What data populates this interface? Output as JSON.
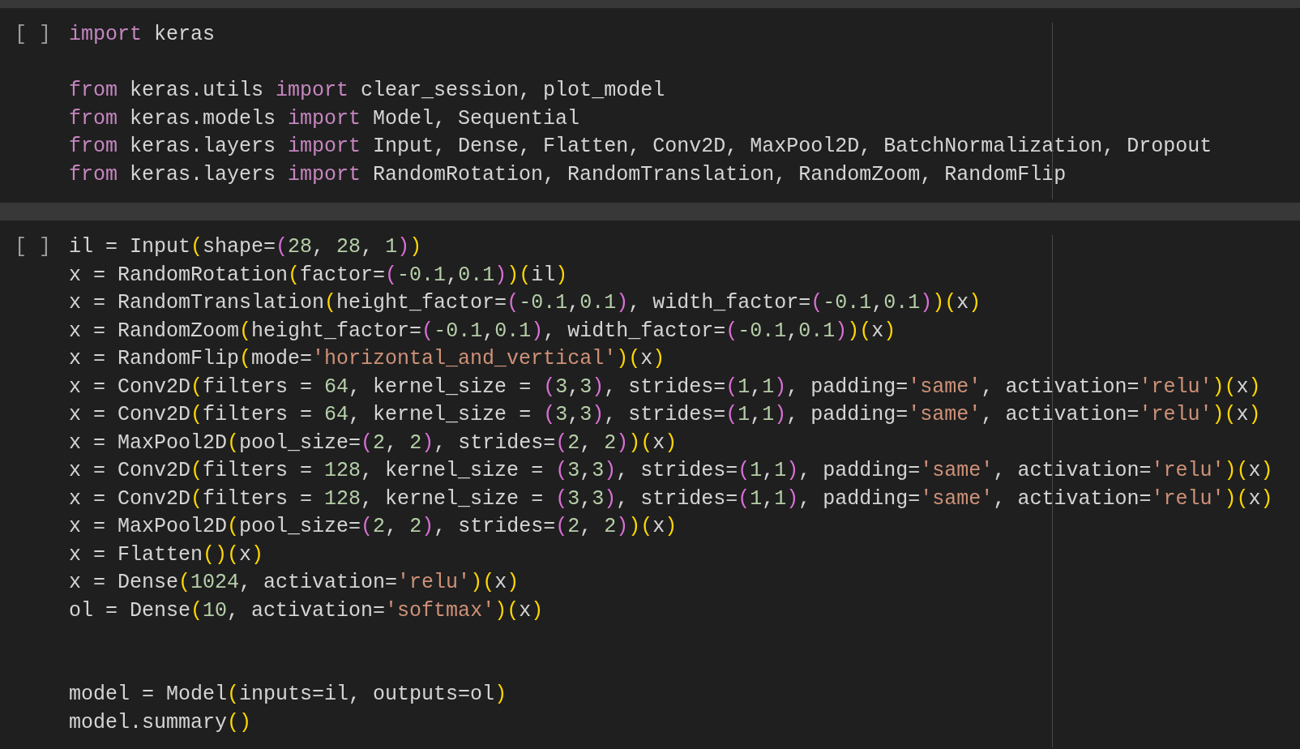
{
  "cells": [
    {
      "execution_count": "[ ]",
      "lines": [
        {
          "kind": "code",
          "tokens": [
            {
              "kind": "kw",
              "text": "import"
            },
            {
              "kind": "id",
              "text": " keras"
            }
          ]
        },
        {
          "kind": "blank"
        },
        {
          "kind": "code",
          "tokens": [
            {
              "kind": "kw",
              "text": "from"
            },
            {
              "kind": "id",
              "text": " keras.utils "
            },
            {
              "kind": "kw",
              "text": "import"
            },
            {
              "kind": "id",
              "text": " clear_session, plot_model"
            }
          ]
        },
        {
          "kind": "code",
          "tokens": [
            {
              "kind": "kw",
              "text": "from"
            },
            {
              "kind": "id",
              "text": " keras.models "
            },
            {
              "kind": "kw",
              "text": "import"
            },
            {
              "kind": "id",
              "text": " Model, Sequential"
            }
          ]
        },
        {
          "kind": "code",
          "tokens": [
            {
              "kind": "kw",
              "text": "from"
            },
            {
              "kind": "id",
              "text": " keras.layers "
            },
            {
              "kind": "kw",
              "text": "import"
            },
            {
              "kind": "id",
              "text": " Input, Dense, Flatten, Conv2D, MaxPool2D, BatchNormalization, Dropout"
            }
          ]
        },
        {
          "kind": "code",
          "tokens": [
            {
              "kind": "kw",
              "text": "from"
            },
            {
              "kind": "id",
              "text": " keras.layers "
            },
            {
              "kind": "kw",
              "text": "import"
            },
            {
              "kind": "id",
              "text": " RandomRotation, RandomTranslation, RandomZoom, RandomFlip"
            }
          ]
        }
      ]
    },
    {
      "execution_count": "[ ]",
      "lines": [
        {
          "kind": "code",
          "tokens": [
            {
              "kind": "id",
              "text": "il = Input"
            },
            {
              "kind": "p1",
              "text": "("
            },
            {
              "kind": "id",
              "text": "shape="
            },
            {
              "kind": "p2",
              "text": "("
            },
            {
              "kind": "num",
              "text": "28"
            },
            {
              "kind": "id",
              "text": ", "
            },
            {
              "kind": "num",
              "text": "28"
            },
            {
              "kind": "id",
              "text": ", "
            },
            {
              "kind": "num",
              "text": "1"
            },
            {
              "kind": "p2",
              "text": ")"
            },
            {
              "kind": "p1",
              "text": ")"
            }
          ]
        },
        {
          "kind": "code",
          "tokens": [
            {
              "kind": "id",
              "text": "x = RandomRotation"
            },
            {
              "kind": "p1",
              "text": "("
            },
            {
              "kind": "id",
              "text": "factor="
            },
            {
              "kind": "p2",
              "text": "("
            },
            {
              "kind": "num",
              "text": "-0.1"
            },
            {
              "kind": "id",
              "text": ","
            },
            {
              "kind": "num",
              "text": "0.1"
            },
            {
              "kind": "p2",
              "text": ")"
            },
            {
              "kind": "p1",
              "text": ")("
            },
            {
              "kind": "id",
              "text": "il"
            },
            {
              "kind": "p1",
              "text": ")"
            }
          ]
        },
        {
          "kind": "code",
          "tokens": [
            {
              "kind": "id",
              "text": "x = RandomTranslation"
            },
            {
              "kind": "p1",
              "text": "("
            },
            {
              "kind": "id",
              "text": "height_factor="
            },
            {
              "kind": "p2",
              "text": "("
            },
            {
              "kind": "num",
              "text": "-0.1"
            },
            {
              "kind": "id",
              "text": ","
            },
            {
              "kind": "num",
              "text": "0.1"
            },
            {
              "kind": "p2",
              "text": ")"
            },
            {
              "kind": "id",
              "text": ", width_factor="
            },
            {
              "kind": "p2",
              "text": "("
            },
            {
              "kind": "num",
              "text": "-0.1"
            },
            {
              "kind": "id",
              "text": ","
            },
            {
              "kind": "num",
              "text": "0.1"
            },
            {
              "kind": "p2",
              "text": ")"
            },
            {
              "kind": "p1",
              "text": ")("
            },
            {
              "kind": "id",
              "text": "x"
            },
            {
              "kind": "p1",
              "text": ")"
            }
          ]
        },
        {
          "kind": "code",
          "tokens": [
            {
              "kind": "id",
              "text": "x = RandomZoom"
            },
            {
              "kind": "p1",
              "text": "("
            },
            {
              "kind": "id",
              "text": "height_factor="
            },
            {
              "kind": "p2",
              "text": "("
            },
            {
              "kind": "num",
              "text": "-0.1"
            },
            {
              "kind": "id",
              "text": ","
            },
            {
              "kind": "num",
              "text": "0.1"
            },
            {
              "kind": "p2",
              "text": ")"
            },
            {
              "kind": "id",
              "text": ", width_factor="
            },
            {
              "kind": "p2",
              "text": "("
            },
            {
              "kind": "num",
              "text": "-0.1"
            },
            {
              "kind": "id",
              "text": ","
            },
            {
              "kind": "num",
              "text": "0.1"
            },
            {
              "kind": "p2",
              "text": ")"
            },
            {
              "kind": "p1",
              "text": ")("
            },
            {
              "kind": "id",
              "text": "x"
            },
            {
              "kind": "p1",
              "text": ")"
            }
          ]
        },
        {
          "kind": "code",
          "tokens": [
            {
              "kind": "id",
              "text": "x = RandomFlip"
            },
            {
              "kind": "p1",
              "text": "("
            },
            {
              "kind": "id",
              "text": "mode="
            },
            {
              "kind": "str",
              "text": "'horizontal_and_vertical'"
            },
            {
              "kind": "p1",
              "text": ")("
            },
            {
              "kind": "id",
              "text": "x"
            },
            {
              "kind": "p1",
              "text": ")"
            }
          ]
        },
        {
          "kind": "code",
          "tokens": [
            {
              "kind": "id",
              "text": "x = Conv2D"
            },
            {
              "kind": "p1",
              "text": "("
            },
            {
              "kind": "id",
              "text": "filters = "
            },
            {
              "kind": "num",
              "text": "64"
            },
            {
              "kind": "id",
              "text": ", kernel_size = "
            },
            {
              "kind": "p2",
              "text": "("
            },
            {
              "kind": "num",
              "text": "3"
            },
            {
              "kind": "id",
              "text": ","
            },
            {
              "kind": "num",
              "text": "3"
            },
            {
              "kind": "p2",
              "text": ")"
            },
            {
              "kind": "id",
              "text": ", strides="
            },
            {
              "kind": "p2",
              "text": "("
            },
            {
              "kind": "num",
              "text": "1"
            },
            {
              "kind": "id",
              "text": ","
            },
            {
              "kind": "num",
              "text": "1"
            },
            {
              "kind": "p2",
              "text": ")"
            },
            {
              "kind": "id",
              "text": ", padding="
            },
            {
              "kind": "str",
              "text": "'same'"
            },
            {
              "kind": "id",
              "text": ", activation="
            },
            {
              "kind": "str",
              "text": "'relu'"
            },
            {
              "kind": "p1",
              "text": ")("
            },
            {
              "kind": "id",
              "text": "x"
            },
            {
              "kind": "p1",
              "text": ")"
            }
          ]
        },
        {
          "kind": "code",
          "tokens": [
            {
              "kind": "id",
              "text": "x = Conv2D"
            },
            {
              "kind": "p1",
              "text": "("
            },
            {
              "kind": "id",
              "text": "filters = "
            },
            {
              "kind": "num",
              "text": "64"
            },
            {
              "kind": "id",
              "text": ", kernel_size = "
            },
            {
              "kind": "p2",
              "text": "("
            },
            {
              "kind": "num",
              "text": "3"
            },
            {
              "kind": "id",
              "text": ","
            },
            {
              "kind": "num",
              "text": "3"
            },
            {
              "kind": "p2",
              "text": ")"
            },
            {
              "kind": "id",
              "text": ", strides="
            },
            {
              "kind": "p2",
              "text": "("
            },
            {
              "kind": "num",
              "text": "1"
            },
            {
              "kind": "id",
              "text": ","
            },
            {
              "kind": "num",
              "text": "1"
            },
            {
              "kind": "p2",
              "text": ")"
            },
            {
              "kind": "id",
              "text": ", padding="
            },
            {
              "kind": "str",
              "text": "'same'"
            },
            {
              "kind": "id",
              "text": ", activation="
            },
            {
              "kind": "str",
              "text": "'relu'"
            },
            {
              "kind": "p1",
              "text": ")("
            },
            {
              "kind": "id",
              "text": "x"
            },
            {
              "kind": "p1",
              "text": ")"
            }
          ]
        },
        {
          "kind": "code",
          "tokens": [
            {
              "kind": "id",
              "text": "x = MaxPool2D"
            },
            {
              "kind": "p1",
              "text": "("
            },
            {
              "kind": "id",
              "text": "pool_size="
            },
            {
              "kind": "p2",
              "text": "("
            },
            {
              "kind": "num",
              "text": "2"
            },
            {
              "kind": "id",
              "text": ", "
            },
            {
              "kind": "num",
              "text": "2"
            },
            {
              "kind": "p2",
              "text": ")"
            },
            {
              "kind": "id",
              "text": ", strides="
            },
            {
              "kind": "p2",
              "text": "("
            },
            {
              "kind": "num",
              "text": "2"
            },
            {
              "kind": "id",
              "text": ", "
            },
            {
              "kind": "num",
              "text": "2"
            },
            {
              "kind": "p2",
              "text": ")"
            },
            {
              "kind": "p1",
              "text": ")("
            },
            {
              "kind": "id",
              "text": "x"
            },
            {
              "kind": "p1",
              "text": ")"
            }
          ]
        },
        {
          "kind": "code",
          "tokens": [
            {
              "kind": "id",
              "text": "x = Conv2D"
            },
            {
              "kind": "p1",
              "text": "("
            },
            {
              "kind": "id",
              "text": "filters = "
            },
            {
              "kind": "num",
              "text": "128"
            },
            {
              "kind": "id",
              "text": ", kernel_size = "
            },
            {
              "kind": "p2",
              "text": "("
            },
            {
              "kind": "num",
              "text": "3"
            },
            {
              "kind": "id",
              "text": ","
            },
            {
              "kind": "num",
              "text": "3"
            },
            {
              "kind": "p2",
              "text": ")"
            },
            {
              "kind": "id",
              "text": ", strides="
            },
            {
              "kind": "p2",
              "text": "("
            },
            {
              "kind": "num",
              "text": "1"
            },
            {
              "kind": "id",
              "text": ","
            },
            {
              "kind": "num",
              "text": "1"
            },
            {
              "kind": "p2",
              "text": ")"
            },
            {
              "kind": "id",
              "text": ", padding="
            },
            {
              "kind": "str",
              "text": "'same'"
            },
            {
              "kind": "id",
              "text": ", activation="
            },
            {
              "kind": "str",
              "text": "'relu'"
            },
            {
              "kind": "p1",
              "text": ")("
            },
            {
              "kind": "id",
              "text": "x"
            },
            {
              "kind": "p1",
              "text": ")"
            }
          ]
        },
        {
          "kind": "code",
          "tokens": [
            {
              "kind": "id",
              "text": "x = Conv2D"
            },
            {
              "kind": "p1",
              "text": "("
            },
            {
              "kind": "id",
              "text": "filters = "
            },
            {
              "kind": "num",
              "text": "128"
            },
            {
              "kind": "id",
              "text": ", kernel_size = "
            },
            {
              "kind": "p2",
              "text": "("
            },
            {
              "kind": "num",
              "text": "3"
            },
            {
              "kind": "id",
              "text": ","
            },
            {
              "kind": "num",
              "text": "3"
            },
            {
              "kind": "p2",
              "text": ")"
            },
            {
              "kind": "id",
              "text": ", strides="
            },
            {
              "kind": "p2",
              "text": "("
            },
            {
              "kind": "num",
              "text": "1"
            },
            {
              "kind": "id",
              "text": ","
            },
            {
              "kind": "num",
              "text": "1"
            },
            {
              "kind": "p2",
              "text": ")"
            },
            {
              "kind": "id",
              "text": ", padding="
            },
            {
              "kind": "str",
              "text": "'same'"
            },
            {
              "kind": "id",
              "text": ", activation="
            },
            {
              "kind": "str",
              "text": "'relu'"
            },
            {
              "kind": "p1",
              "text": ")("
            },
            {
              "kind": "id",
              "text": "x"
            },
            {
              "kind": "p1",
              "text": ")"
            }
          ]
        },
        {
          "kind": "code",
          "tokens": [
            {
              "kind": "id",
              "text": "x = MaxPool2D"
            },
            {
              "kind": "p1",
              "text": "("
            },
            {
              "kind": "id",
              "text": "pool_size="
            },
            {
              "kind": "p2",
              "text": "("
            },
            {
              "kind": "num",
              "text": "2"
            },
            {
              "kind": "id",
              "text": ", "
            },
            {
              "kind": "num",
              "text": "2"
            },
            {
              "kind": "p2",
              "text": ")"
            },
            {
              "kind": "id",
              "text": ", strides="
            },
            {
              "kind": "p2",
              "text": "("
            },
            {
              "kind": "num",
              "text": "2"
            },
            {
              "kind": "id",
              "text": ", "
            },
            {
              "kind": "num",
              "text": "2"
            },
            {
              "kind": "p2",
              "text": ")"
            },
            {
              "kind": "p1",
              "text": ")("
            },
            {
              "kind": "id",
              "text": "x"
            },
            {
              "kind": "p1",
              "text": ")"
            }
          ]
        },
        {
          "kind": "code",
          "tokens": [
            {
              "kind": "id",
              "text": "x = Flatten"
            },
            {
              "kind": "p1",
              "text": "()("
            },
            {
              "kind": "id",
              "text": "x"
            },
            {
              "kind": "p1",
              "text": ")"
            }
          ]
        },
        {
          "kind": "code",
          "tokens": [
            {
              "kind": "id",
              "text": "x = Dense"
            },
            {
              "kind": "p1",
              "text": "("
            },
            {
              "kind": "num",
              "text": "1024"
            },
            {
              "kind": "id",
              "text": ", activation="
            },
            {
              "kind": "str",
              "text": "'relu'"
            },
            {
              "kind": "p1",
              "text": ")("
            },
            {
              "kind": "id",
              "text": "x"
            },
            {
              "kind": "p1",
              "text": ")"
            }
          ]
        },
        {
          "kind": "code",
          "tokens": [
            {
              "kind": "id",
              "text": "ol = Dense"
            },
            {
              "kind": "p1",
              "text": "("
            },
            {
              "kind": "num",
              "text": "10"
            },
            {
              "kind": "id",
              "text": ", activation="
            },
            {
              "kind": "str",
              "text": "'softmax'"
            },
            {
              "kind": "p1",
              "text": ")("
            },
            {
              "kind": "id",
              "text": "x"
            },
            {
              "kind": "p1",
              "text": ")"
            }
          ]
        },
        {
          "kind": "blank"
        },
        {
          "kind": "blank"
        },
        {
          "kind": "code",
          "tokens": [
            {
              "kind": "id",
              "text": "model = Model"
            },
            {
              "kind": "p1",
              "text": "("
            },
            {
              "kind": "id",
              "text": "inputs=il, outputs=ol"
            },
            {
              "kind": "p1",
              "text": ")"
            }
          ]
        },
        {
          "kind": "code",
          "tokens": [
            {
              "kind": "id",
              "text": "model.summary"
            },
            {
              "kind": "p1",
              "text": "()"
            }
          ]
        }
      ]
    }
  ]
}
